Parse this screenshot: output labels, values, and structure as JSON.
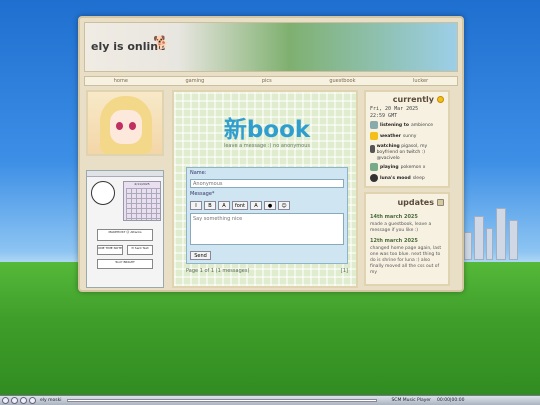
{
  "header": {
    "title": "ely is online",
    "mascot_icon": "dog-icon"
  },
  "nav": {
    "items": [
      "home",
      "gaming",
      "pics",
      "guestbook",
      "lucker"
    ]
  },
  "widget": {
    "calendar_title": "4/11/2025",
    "tiles": [
      "MAKEHOST ☺ Attacks",
      "ONE TIME NOTE",
      "✉ Sent Text",
      "Tool? BRIGHT"
    ]
  },
  "guestbook": {
    "title": "新book",
    "subtitle": "leave a message :) no anonymous",
    "name_label": "Name:",
    "name_placeholder": "Anonymous",
    "message_label": "Message*",
    "message_placeholder": "Say something nice",
    "send_label": "Send",
    "page_info": "Page 1 of 1 (1 messages)",
    "last_label": "[1]",
    "tool_labels": [
      "I",
      "B",
      "A",
      "font",
      "A",
      "●",
      "☺"
    ]
  },
  "currently": {
    "heading": "currently",
    "datetime_line1": "Fri, 20 Mar 2025",
    "datetime_line2": "22:59 GMT",
    "statuses": [
      {
        "label": "listening to",
        "value": "ambience",
        "icon": "headphones-icon"
      },
      {
        "label": "weather",
        "value": "sunny",
        "icon": "sun-icon"
      },
      {
        "label": "watching",
        "value": "pigasol, my boyfriend on twitch :) @vacivelo",
        "icon": "tv-icon"
      },
      {
        "label": "playing",
        "value": "pokemon x",
        "icon": "gamepad-icon"
      },
      {
        "label": "luna's mood",
        "value": "sleep",
        "icon": "cat-icon"
      }
    ]
  },
  "updates": {
    "heading": "updates",
    "entries": [
      {
        "date": "14th march 2025",
        "text": "made a guestbook, leave a message if you like :)"
      },
      {
        "date": "12th march 2025",
        "text": "changed home page again, last one was too blue. next thing to do is shrine for luna :) also finally moved all the css out of my"
      }
    ]
  },
  "taskbar": {
    "left_label": "ely moski",
    "player_label": "SCM Music Player",
    "time": "00:00|00:00"
  }
}
